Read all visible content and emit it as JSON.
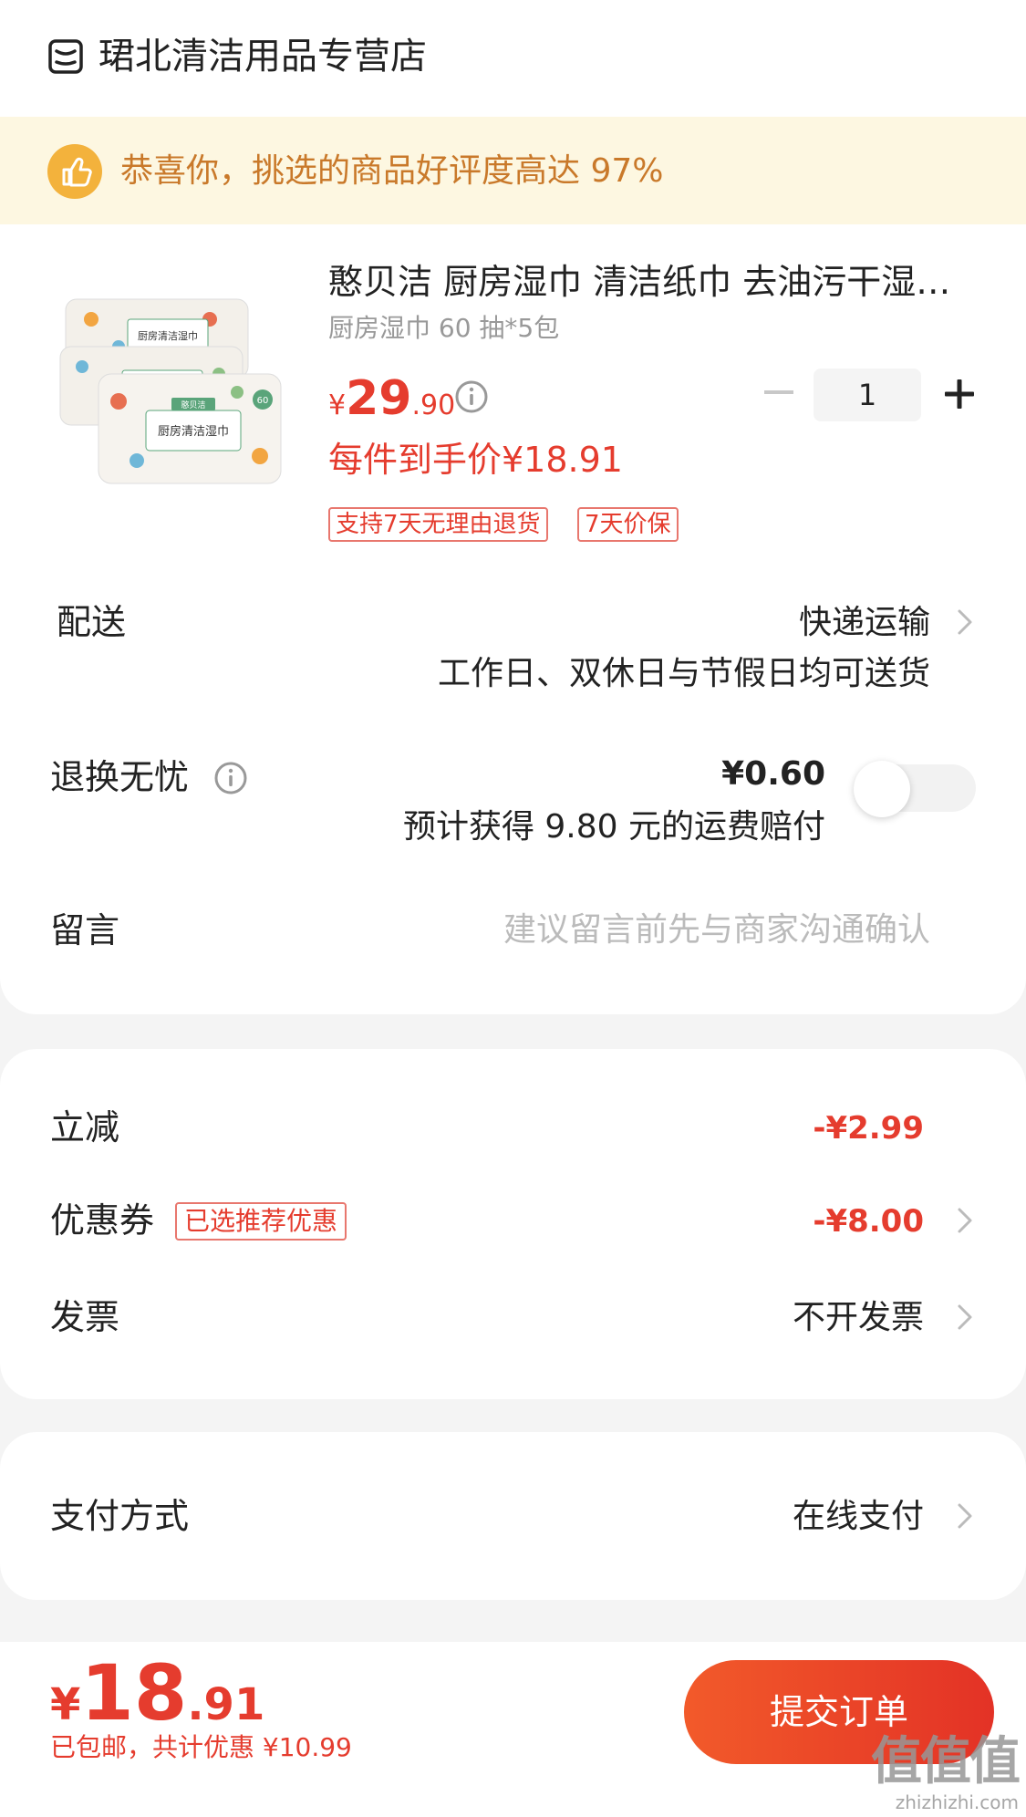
{
  "store": {
    "name": "珺北清洁用品专营店",
    "icon": "store-icon"
  },
  "banner": {
    "text": "恭喜你，挑选的商品好评度高达 97%",
    "icon": "thumbs-up-icon",
    "color": "#c9792a"
  },
  "product": {
    "title": "憨贝洁 厨房湿巾 清洁纸巾 去油污干湿两用",
    "sku": "厨房湿巾 60 抽*5包",
    "price": {
      "currency": "¥",
      "integer": "29",
      "decimal": ".90"
    },
    "each_price": "每件到手价¥18.91",
    "tags": [
      "支持7天无理由退货",
      "7天价保"
    ],
    "quantity": "1",
    "image": {
      "package_label": "厨房清洁湿巾",
      "badge": "60",
      "top_label": "憨贝洁"
    }
  },
  "shipping": {
    "label": "配送",
    "value": "快递运输",
    "note": "工作日、双休日与节假日均可送货"
  },
  "return_insurance": {
    "label": "退换无忧",
    "price": "¥0.60",
    "note": "预计获得 9.80 元的运费赔付",
    "enabled": false
  },
  "message": {
    "label": "留言",
    "placeholder": "建议留言前先与商家沟通确认"
  },
  "discounts": {
    "instant": {
      "label": "立减",
      "value": "-¥2.99"
    },
    "coupon": {
      "label": "优惠券",
      "tag": "已选推荐优惠",
      "value": "-¥8.00"
    },
    "invoice": {
      "label": "发票",
      "value": "不开发票"
    }
  },
  "payment": {
    "label": "支付方式",
    "value": "在线支付"
  },
  "footer": {
    "total": {
      "currency": "¥",
      "integer": "18",
      "decimal": ".91"
    },
    "note": "已包邮，共计优惠 ¥10.99",
    "submit_label": "提交订单"
  },
  "watermark": {
    "big": "值值值",
    "small": "zhizhizhi.com"
  },
  "colors": {
    "accent": "#e53c2e",
    "banner_bg": "#fdf7e1",
    "submit_gradient_start": "#f25a2a",
    "submit_gradient_end": "#e33226"
  }
}
